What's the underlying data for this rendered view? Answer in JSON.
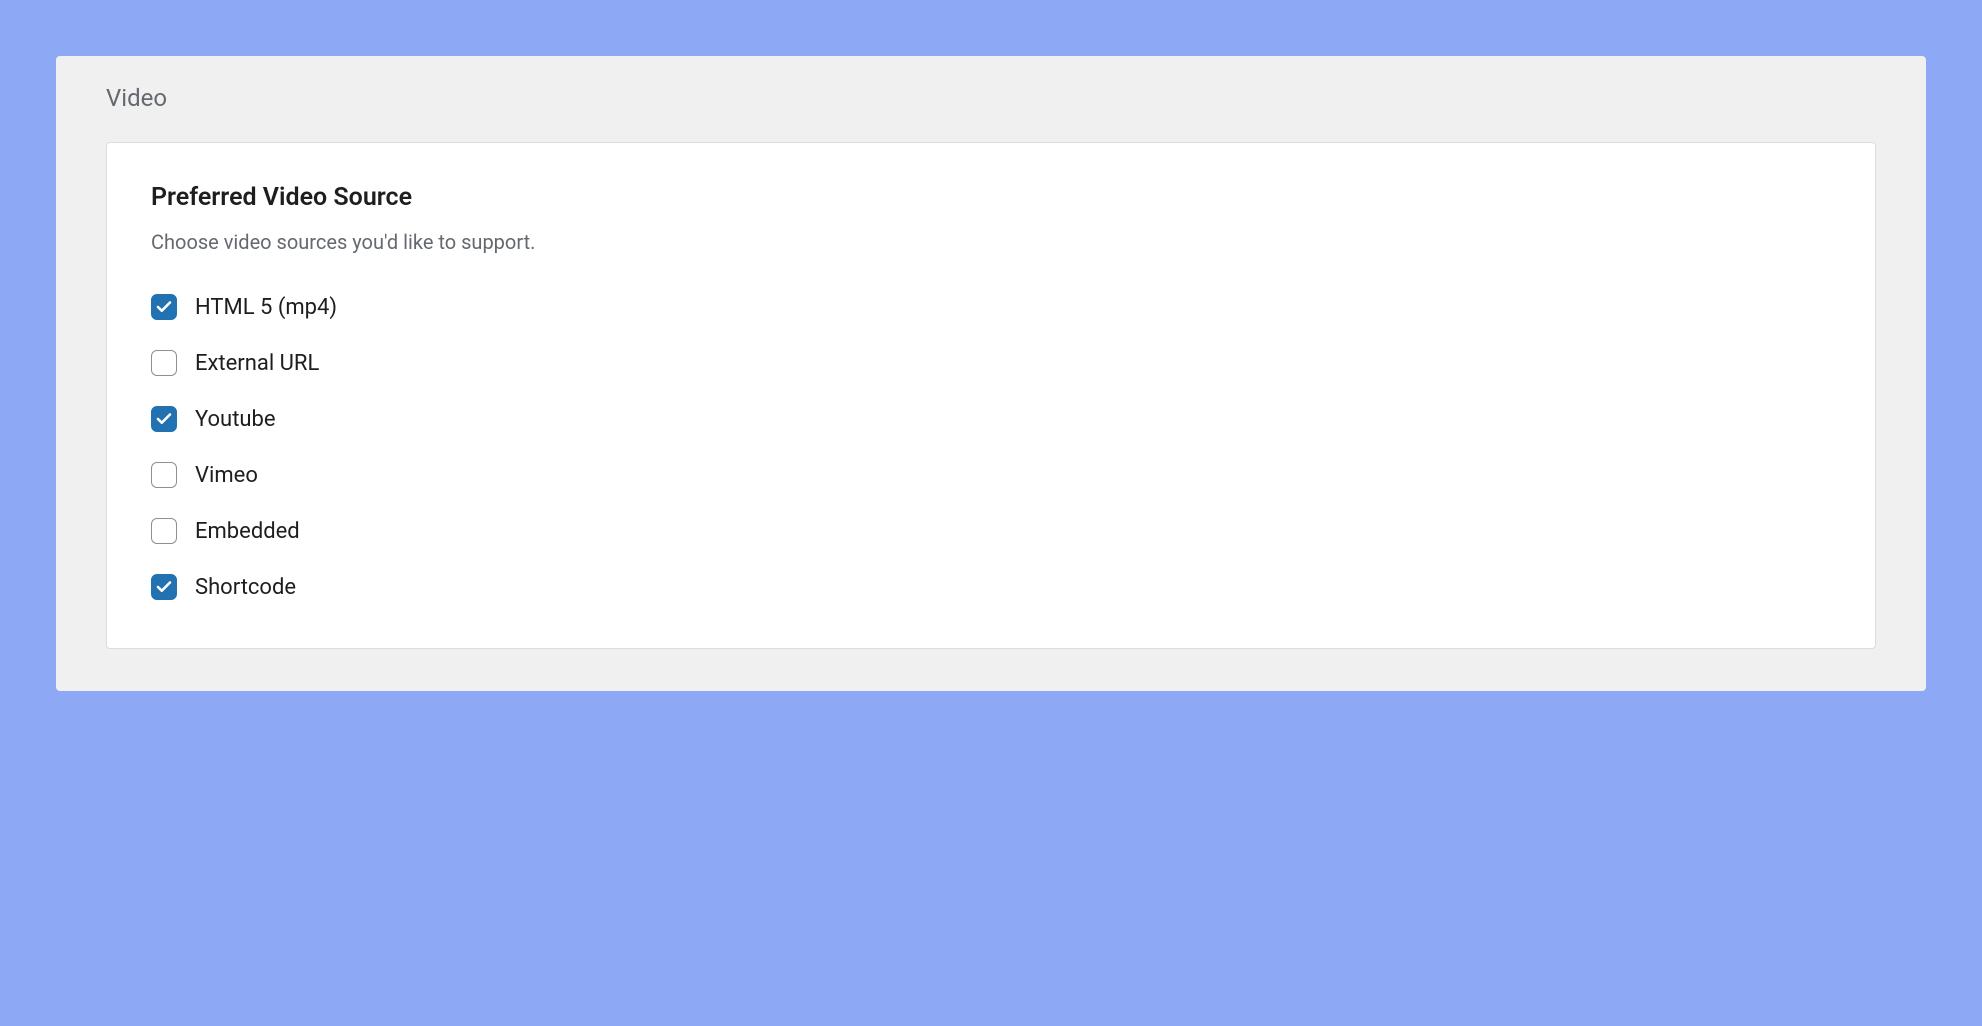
{
  "panel": {
    "title": "Video"
  },
  "section": {
    "heading": "Preferred Video Source",
    "description": "Choose video sources you'd like to support."
  },
  "options": [
    {
      "label": "HTML 5 (mp4)",
      "checked": true
    },
    {
      "label": "External URL",
      "checked": false
    },
    {
      "label": "Youtube",
      "checked": true
    },
    {
      "label": "Vimeo",
      "checked": false
    },
    {
      "label": "Embedded",
      "checked": false
    },
    {
      "label": "Shortcode",
      "checked": true
    }
  ]
}
